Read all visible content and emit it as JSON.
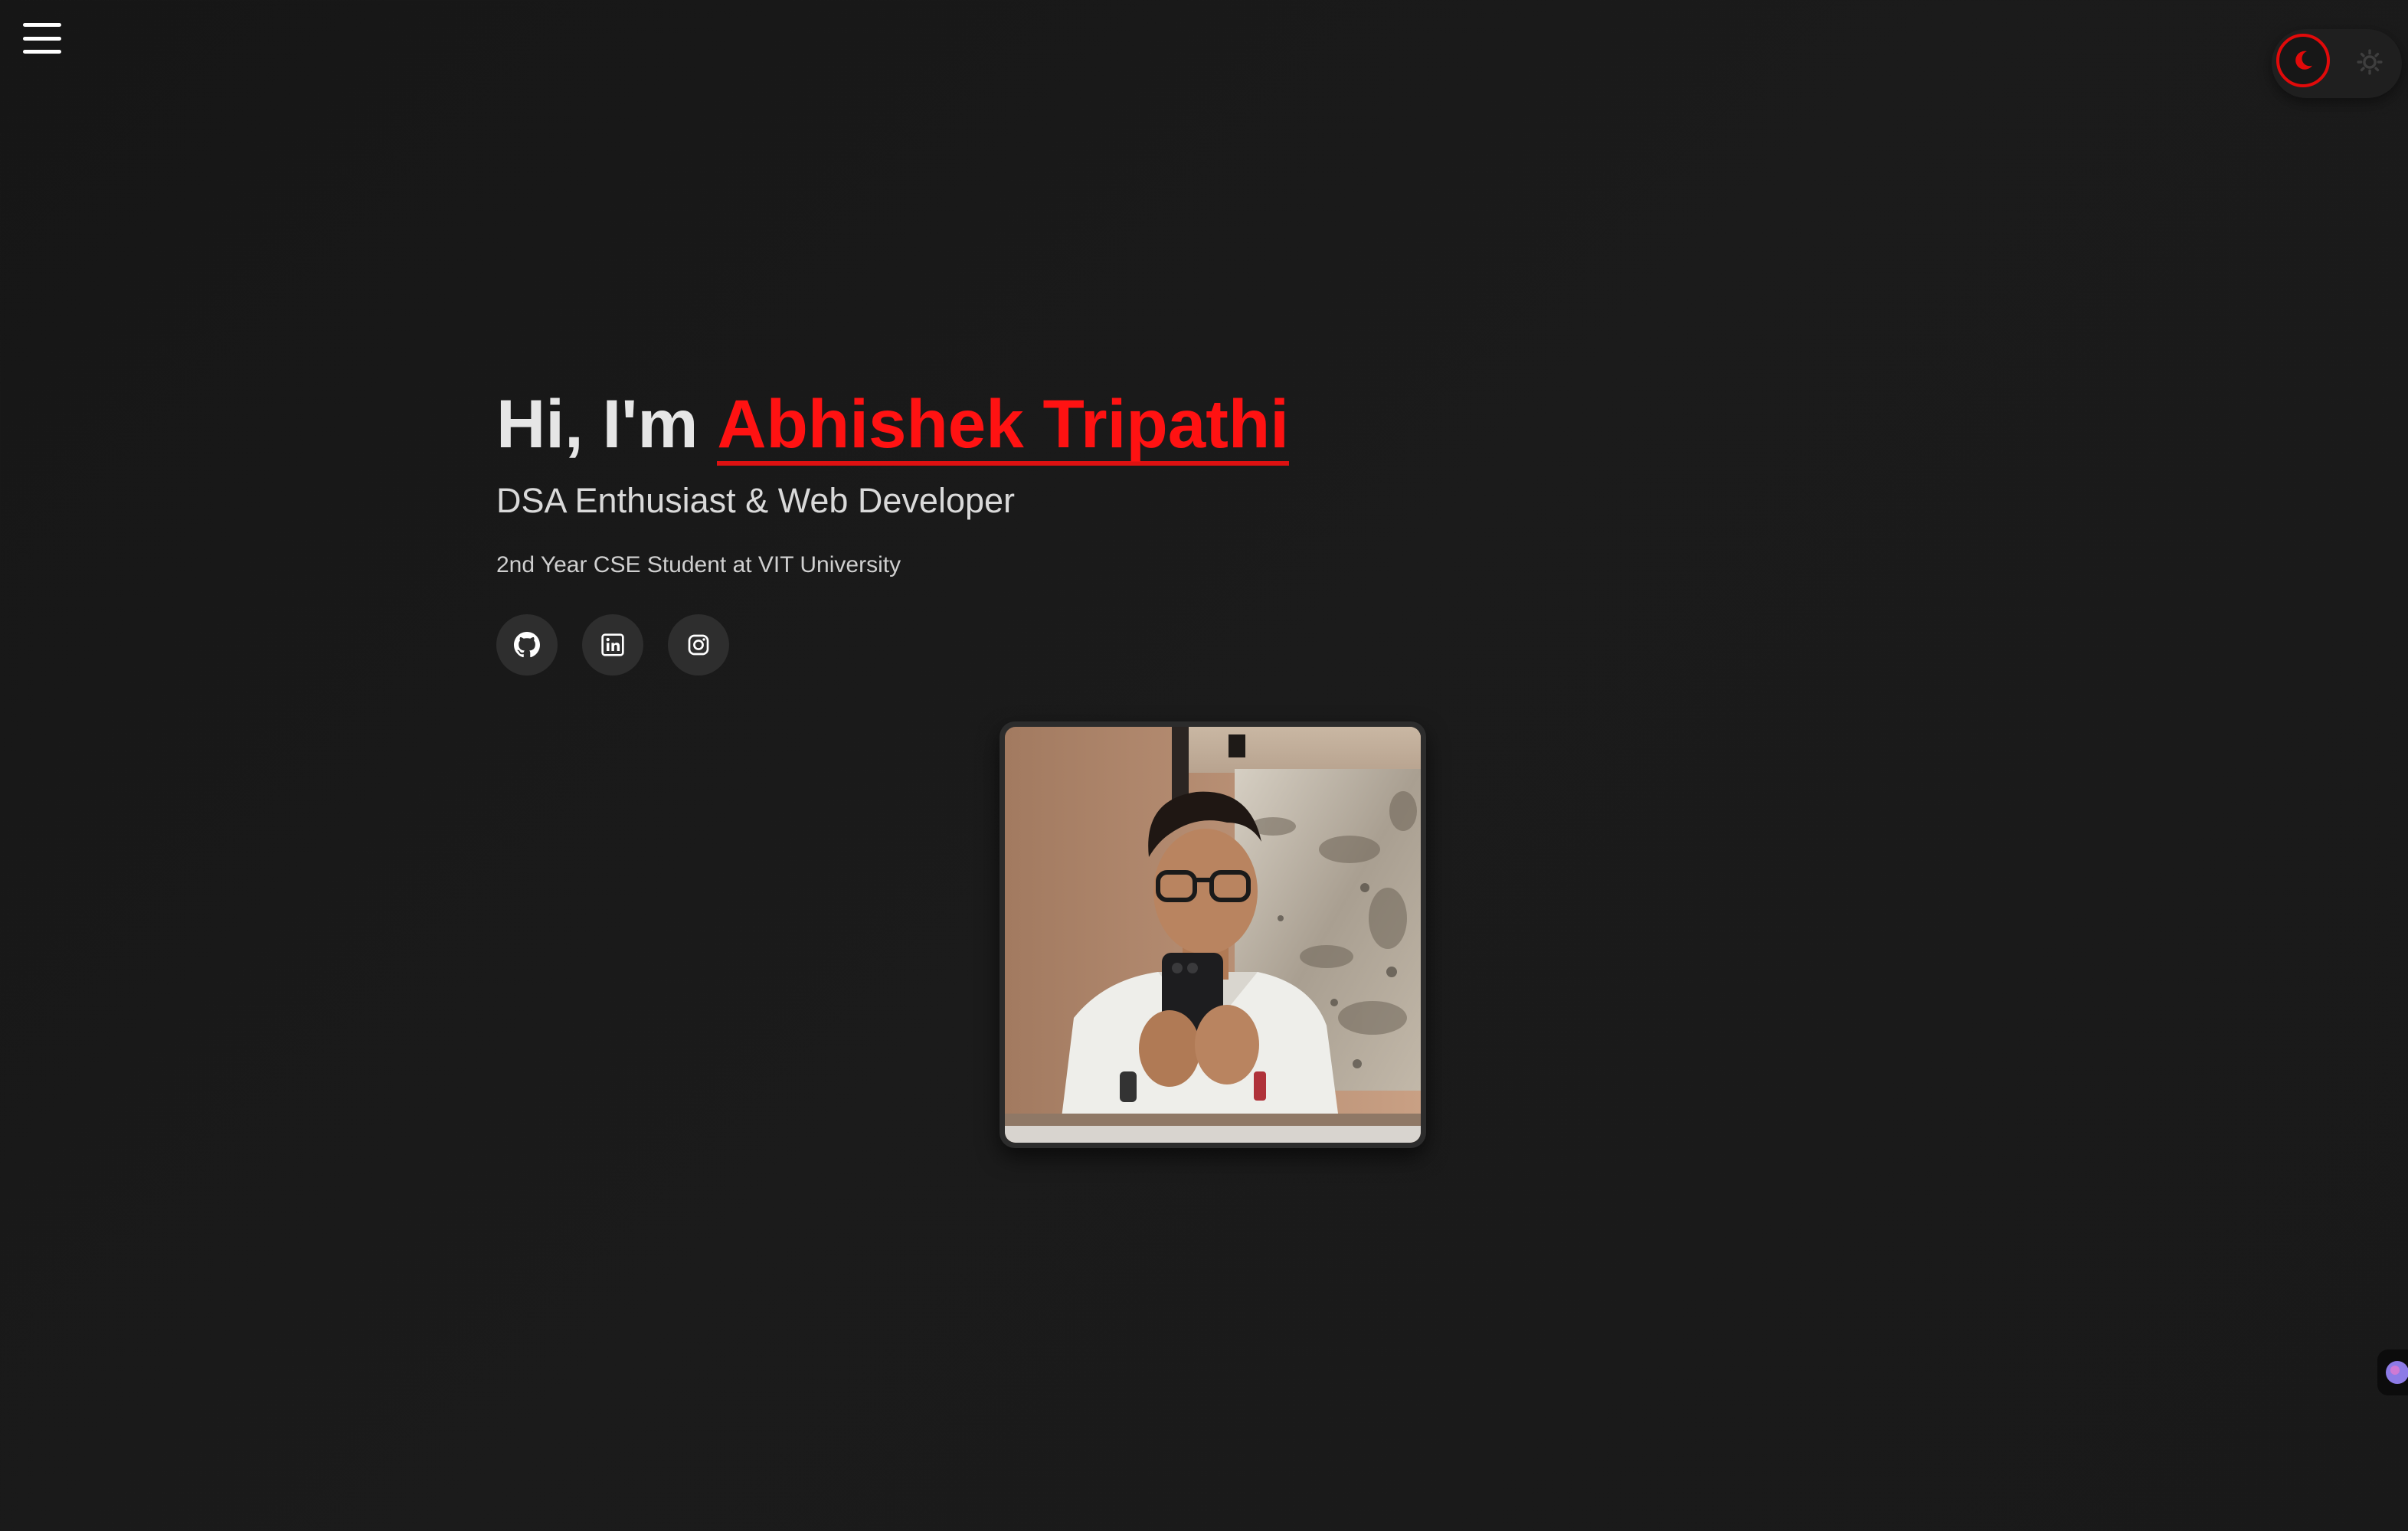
{
  "nav": {
    "menu_icon": "hamburger-menu-icon"
  },
  "theme_toggle": {
    "active": "dark",
    "dark_icon": "moon-icon",
    "light_icon": "sun-icon",
    "accent_color": "#e10a0a"
  },
  "hero": {
    "greeting": "Hi, I'm ",
    "name": "Abhishek Tripathi",
    "subtitle": "DSA Enthusiast & Web Developer",
    "tagline": "2nd Year CSE Student at VIT University"
  },
  "socials": [
    {
      "name": "GitHub",
      "icon": "github-icon"
    },
    {
      "name": "LinkedIn",
      "icon": "linkedin-icon"
    },
    {
      "name": "Instagram",
      "icon": "instagram-icon"
    }
  ],
  "profile_photo": {
    "alt": "Profile photo"
  },
  "colors": {
    "background": "#191919",
    "accent": "#ff1212",
    "text": "#e6e6e6"
  }
}
